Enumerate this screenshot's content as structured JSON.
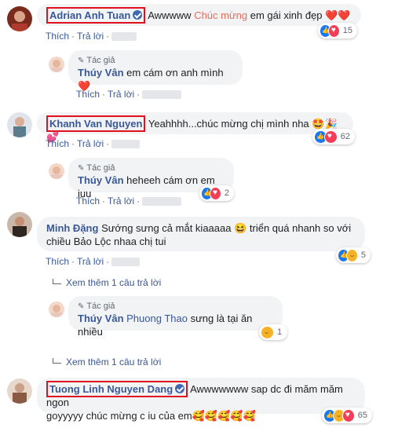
{
  "comments": [
    {
      "name": "Adrian Anh Tuan",
      "text_pre": "Awwwww ",
      "text_highlight": "Chúc mừng",
      "text_post": " em gái xinh đẹp",
      "emoji": "❤️❤️",
      "like": "Thích",
      "reply": "Trả lời",
      "reaction_count": "15"
    },
    {
      "name": "Khanh Van Nguyen",
      "text": "Yeahhhh...chúc mừng chị mình nha",
      "emoji": "🤩🎉💕",
      "like": "Thích",
      "reply": "Trả lời",
      "reaction_count": "62"
    },
    {
      "name": "Minh Đặng",
      "text_line1": "Sướng sưng cả mắt kiaaaaa",
      "emoji": "😆",
      "text_line1b": " triển quá nhanh so với",
      "text_line2": "chiều Bảo Lộc nhaa chị tui",
      "like": "Thích",
      "reply": "Trả lời",
      "reaction_count": "5",
      "see_more": "Xem thêm 1 câu trả lời"
    },
    {
      "name": "Tuong Linh Nguyen Dang",
      "text_line1": "Awwwwwww sap dc đi măm măm ngon",
      "text_line2": "goyyyyy chúc mừng c iu của em",
      "emoji": "🥰🥰🥰🥰🥰",
      "reaction_count": "65",
      "see_more": "Xem thêm 1 câu trả lời"
    }
  ],
  "replies": [
    {
      "author_tag": "Tác giả",
      "name": "Thúy Vân",
      "text": "em cám ơn anh mình",
      "emoji": "❤️",
      "like": "Thích",
      "reply": "Trả lời"
    },
    {
      "author_tag": "Tác giả",
      "name": "Thúy Vân",
      "text": "heheeh cám ơn em iuu",
      "like": "Thích",
      "reply": "Trả lời",
      "reaction_count": "2"
    },
    {
      "author_tag": "Tác giả",
      "name": "Thúy Vân",
      "mention": "Phuong Thao",
      "text": " sưng là tại ăn nhiều",
      "like": "Thích",
      "reply": "Trả lời",
      "reaction_count": "1"
    }
  ],
  "colors": {
    "name_link": "#385898",
    "highlight_box": "#e0101e",
    "bubble_bg": "#f2f3f5"
  }
}
